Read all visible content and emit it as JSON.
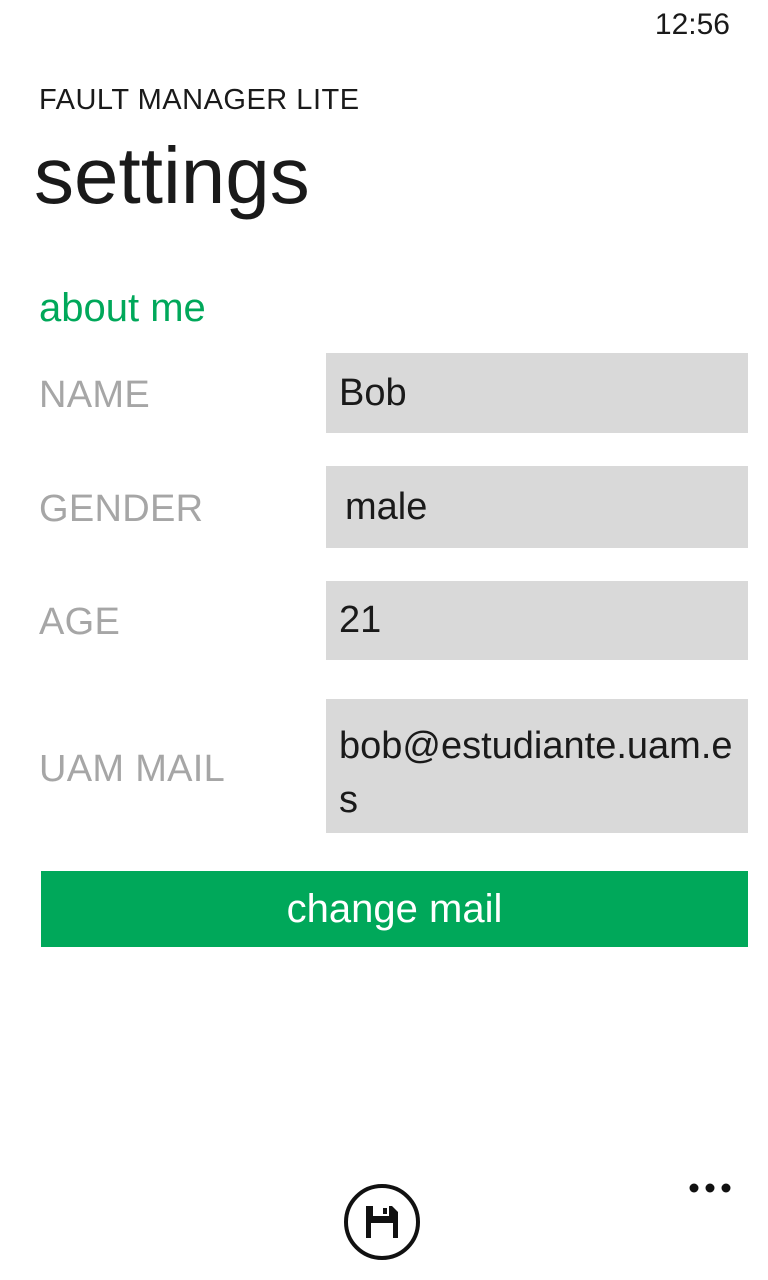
{
  "status_bar": {
    "time": "12:56"
  },
  "app": {
    "title": "FAULT MANAGER LITE"
  },
  "page": {
    "title": "settings"
  },
  "section": {
    "header": "about me",
    "accent_color": "#00a85a"
  },
  "fields": {
    "name": {
      "label": "NAME",
      "value": "Bob"
    },
    "gender": {
      "label": "GENDER",
      "value": "male"
    },
    "age": {
      "label": "AGE",
      "value": "21"
    },
    "uam_mail": {
      "label": "UAM MAIL",
      "value": "bob@estudiante.uam.es"
    }
  },
  "buttons": {
    "change_mail": "change mail"
  },
  "app_bar": {
    "save_icon": "save-icon",
    "more_icon": "more-icon"
  }
}
